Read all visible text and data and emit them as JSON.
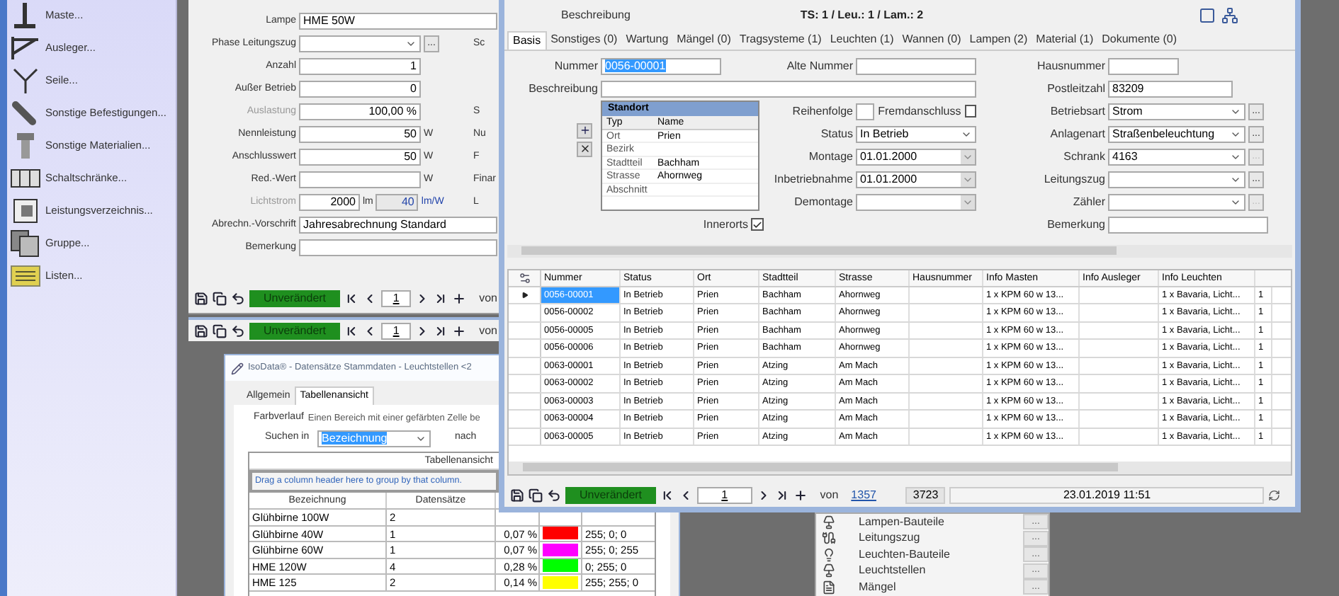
{
  "sidebar": {
    "items": [
      {
        "label": "Maste...",
        "kind": "mast"
      },
      {
        "label": "Ausleger...",
        "kind": "arm"
      },
      {
        "label": "Seile...",
        "kind": "rope"
      },
      {
        "label": "Sonstige Befestigungen...",
        "kind": "clamp"
      },
      {
        "label": "Sonstige Materialien...",
        "kind": "bolt"
      },
      {
        "label": "Schaltschränke...",
        "kind": "cabinet"
      },
      {
        "label": "Leistungsverzeichnis...",
        "kind": "book"
      },
      {
        "label": "Gruppe...",
        "kind": "group"
      },
      {
        "label": "Listen...",
        "kind": "list"
      }
    ]
  },
  "back_window": {
    "fields": [
      {
        "kind": "text",
        "label": "Lampe",
        "value": "HME 50W",
        "disabled": false
      },
      {
        "kind": "dropdown",
        "label": "Phase Leitungszug",
        "more": "...",
        "side": "Sc",
        "disabled": false
      },
      {
        "kind": "number",
        "label": "Anzahl",
        "value": "1",
        "disabled": false
      },
      {
        "kind": "number",
        "label": "Außer Betrieb",
        "value": "0",
        "disabled": false
      },
      {
        "kind": "number",
        "label": "Auslastung",
        "value": "100,00 %",
        "side": "S",
        "disabled": true
      },
      {
        "kind": "number",
        "label": "Nennleistung",
        "value": "50",
        "unit": "W",
        "side": "Nu",
        "disabled": false
      },
      {
        "kind": "number",
        "label": "Anschlusswert",
        "value": "50",
        "unit": "W",
        "side": "F",
        "disabled": false
      },
      {
        "kind": "number",
        "label": "Red.-Wert",
        "unit": "W",
        "side": "Finar",
        "disabled": false
      },
      {
        "kind": "flux",
        "label": "Lichtstrom",
        "value": "2000",
        "unit": "lm",
        "value2": "40",
        "unit2": "lm/W",
        "side": "L",
        "disabled": true
      },
      {
        "kind": "wide",
        "label": "Abrechn.-Vorschrift",
        "value": "Jahresabrechnung Standard",
        "disabled": false
      },
      {
        "kind": "wide",
        "label": "Bemerkung",
        "disabled": false
      }
    ],
    "nav": {
      "status": "Unverändert",
      "page": "1",
      "of": "von"
    }
  },
  "back_window_2": {
    "nav": {
      "status": "Unverändert",
      "page": "1",
      "of": "von"
    }
  },
  "main_window": {
    "caption": "Beschreibung",
    "summary": "TS: 1 / Leu.: 1 / Lam.: 2",
    "tabs": [
      {
        "label": "Basis",
        "selected": true
      },
      {
        "label": "Sonstiges (0)",
        "selected": false
      },
      {
        "label": "Wartung",
        "selected": false
      },
      {
        "label": "Mängel (0)",
        "selected": false
      },
      {
        "label": "Tragsysteme (1)",
        "selected": false
      },
      {
        "label": "Leuchten (1)",
        "selected": false
      },
      {
        "label": "Wannen (0)",
        "selected": false
      },
      {
        "label": "Lampen (2)",
        "selected": false
      },
      {
        "label": "Material (1)",
        "selected": false
      },
      {
        "label": "Dokumente (0)",
        "selected": false
      }
    ],
    "form": {
      "nummer": {
        "label": "Nummer",
        "value": "0056-00001",
        "highlighted": true
      },
      "beschreibung": {
        "label": "Beschreibung"
      },
      "standort": {
        "title": "Standort",
        "header": [
          "Typ",
          "Name"
        ],
        "rows": [
          {
            "typ": "Ort",
            "name": "Prien"
          },
          {
            "typ": "Bezirk"
          },
          {
            "typ": "Stadtteil",
            "name": "Bachham"
          },
          {
            "typ": "Strasse",
            "name": "Ahornweg"
          },
          {
            "typ": "Abschnitt"
          }
        ]
      },
      "innerorts": {
        "label": "Innerorts",
        "checked": true
      },
      "middle": [
        {
          "kind": "text",
          "label": "Alte Nummer"
        },
        {
          "kind": "order",
          "label": "Reihenfolge",
          "extra_label": "Fremdanschluss",
          "checked": false
        },
        {
          "kind": "dropdown",
          "label": "Status",
          "value": "In Betrieb"
        },
        {
          "kind": "date",
          "label": "Montage",
          "value": "01.01.2000"
        },
        {
          "kind": "date",
          "label": "Inbetriebnahme",
          "value": "01.01.2000"
        },
        {
          "kind": "date",
          "label": "Demontage"
        }
      ],
      "right": [
        {
          "kind": "short",
          "label": "Hausnummer"
        },
        {
          "kind": "text",
          "label": "Postleitzahl",
          "value": "83209"
        },
        {
          "kind": "dropdown_more",
          "label": "Betriebsart",
          "value": "Strom",
          "more": "...",
          "disabled": false
        },
        {
          "kind": "dropdown_more",
          "label": "Anlagenart",
          "value": "Straßenbeleuchtung",
          "more": "...",
          "disabled": false
        },
        {
          "kind": "dropdown_more",
          "label": "Schrank",
          "value": "4163",
          "more": "...",
          "disabled": true
        },
        {
          "kind": "dropdown_more",
          "label": "Leitungszug",
          "more": "...",
          "disabled": false
        },
        {
          "kind": "dropdown_more",
          "label": "Zähler",
          "more": "...",
          "disabled": true
        },
        {
          "kind": "wide",
          "label": "Bemerkung"
        }
      ]
    },
    "table": {
      "columns": [
        "Nummer",
        "Status",
        "Ort",
        "Stadtteil",
        "Strasse",
        "Hausnummer",
        "Info Masten",
        "Info Ausleger",
        "Info Leuchten"
      ],
      "rows": [
        {
          "selected": true,
          "cells": [
            "0056-00001",
            "In Betrieb",
            "Prien",
            "Bachham",
            "Ahornweg",
            null,
            "1 x KPM 60 w 13...",
            null,
            "1 x Bavaria, Licht...",
            "1"
          ]
        },
        {
          "selected": false,
          "cells": [
            "0056-00002",
            "In Betrieb",
            "Prien",
            "Bachham",
            "Ahornweg",
            null,
            "1 x KPM 60 w 13...",
            null,
            "1 x Bavaria, Licht...",
            "1"
          ]
        },
        {
          "selected": false,
          "cells": [
            "0056-00005",
            "In Betrieb",
            "Prien",
            "Bachham",
            "Ahornweg",
            null,
            "1 x KPM 60 w 13...",
            null,
            "1 x Bavaria, Licht...",
            "1"
          ]
        },
        {
          "selected": false,
          "cells": [
            "0056-00006",
            "In Betrieb",
            "Prien",
            "Bachham",
            "Ahornweg",
            null,
            "1 x KPM 60 w 13...",
            null,
            "1 x Bavaria, Licht...",
            "1"
          ]
        },
        {
          "selected": false,
          "cells": [
            "0063-00001",
            "In Betrieb",
            "Prien",
            "Atzing",
            "Am Mach",
            null,
            "1 x KPM 60 w 13...",
            null,
            "1 x Bavaria, Licht...",
            "1"
          ]
        },
        {
          "selected": false,
          "cells": [
            "0063-00002",
            "In Betrieb",
            "Prien",
            "Atzing",
            "Am Mach",
            null,
            "1 x KPM 60 w 13...",
            null,
            "1 x Bavaria, Licht...",
            "1"
          ]
        },
        {
          "selected": false,
          "cells": [
            "0063-00003",
            "In Betrieb",
            "Prien",
            "Atzing",
            "Am Mach",
            null,
            "1 x KPM 60 w 13...",
            null,
            "1 x Bavaria, Licht...",
            "1"
          ]
        },
        {
          "selected": false,
          "cells": [
            "0063-00004",
            "In Betrieb",
            "Prien",
            "Atzing",
            "Am Mach",
            null,
            "1 x KPM 60 w 13...",
            null,
            "1 x Bavaria, Licht...",
            "1"
          ]
        },
        {
          "selected": false,
          "cells": [
            "0063-00005",
            "In Betrieb",
            "Prien",
            "Atzing",
            "Am Mach",
            null,
            "1 x KPM 60 w 13...",
            null,
            "1 x Bavaria, Licht...",
            "1"
          ]
        }
      ]
    },
    "nav": {
      "status": "Unverändert",
      "page": "1",
      "of": "von",
      "total": "1357",
      "count": "3723",
      "timestamp": "23.01.2019 11:51"
    }
  },
  "stats_window": {
    "title": "IsoData® - Datensätze Stammdaten - Leuchtstellen <2",
    "tabs": [
      {
        "label": "Allgemein",
        "selected": false
      },
      {
        "label": "Tabellenansicht",
        "selected": true
      }
    ],
    "gradient_label": "Farbverlauf",
    "gradient_text": "Einen Bereich mit einer gefärbten Zelle be",
    "search_label": "Suchen in",
    "search_value": "Bezeichnung",
    "search_after": "nach",
    "table_title": "Tabellenansicht",
    "group_hint": "Drag a column header here to group by that column.",
    "columns": [
      "Bezeichnung",
      "Datensätze"
    ],
    "rows": [
      {
        "name": "Glühbirne 100W",
        "count": "2"
      },
      {
        "name": "Glühbirne 40W",
        "count": "1",
        "percent": "0,07 %",
        "color": "#ff0000",
        "rgb": "255; 0; 0"
      },
      {
        "name": "Glühbirne 60W",
        "count": "1",
        "percent": "0,07 %",
        "color": "#ff00ff",
        "rgb": "255; 0; 255"
      },
      {
        "name": "HME 120W",
        "count": "4",
        "percent": "0,28 %",
        "color": "#00ff00",
        "rgb": "0; 255; 0"
      },
      {
        "name": "HME 125",
        "count": "2",
        "percent": "0,14 %",
        "color": "#ffff00",
        "rgb": "255; 255; 0"
      }
    ]
  },
  "popup_menu": {
    "items": [
      {
        "label": "Lampen-Bauteile",
        "kind": "lamp",
        "more": "..."
      },
      {
        "label": "Leitungszug",
        "kind": "cable",
        "more": "..."
      },
      {
        "label": "Leuchten-Bauteile",
        "kind": "luminaire",
        "more": "..."
      },
      {
        "label": "Leuchtstellen",
        "kind": "post",
        "more": "..."
      },
      {
        "label": "Mängel",
        "kind": "document",
        "more": "..."
      }
    ]
  }
}
